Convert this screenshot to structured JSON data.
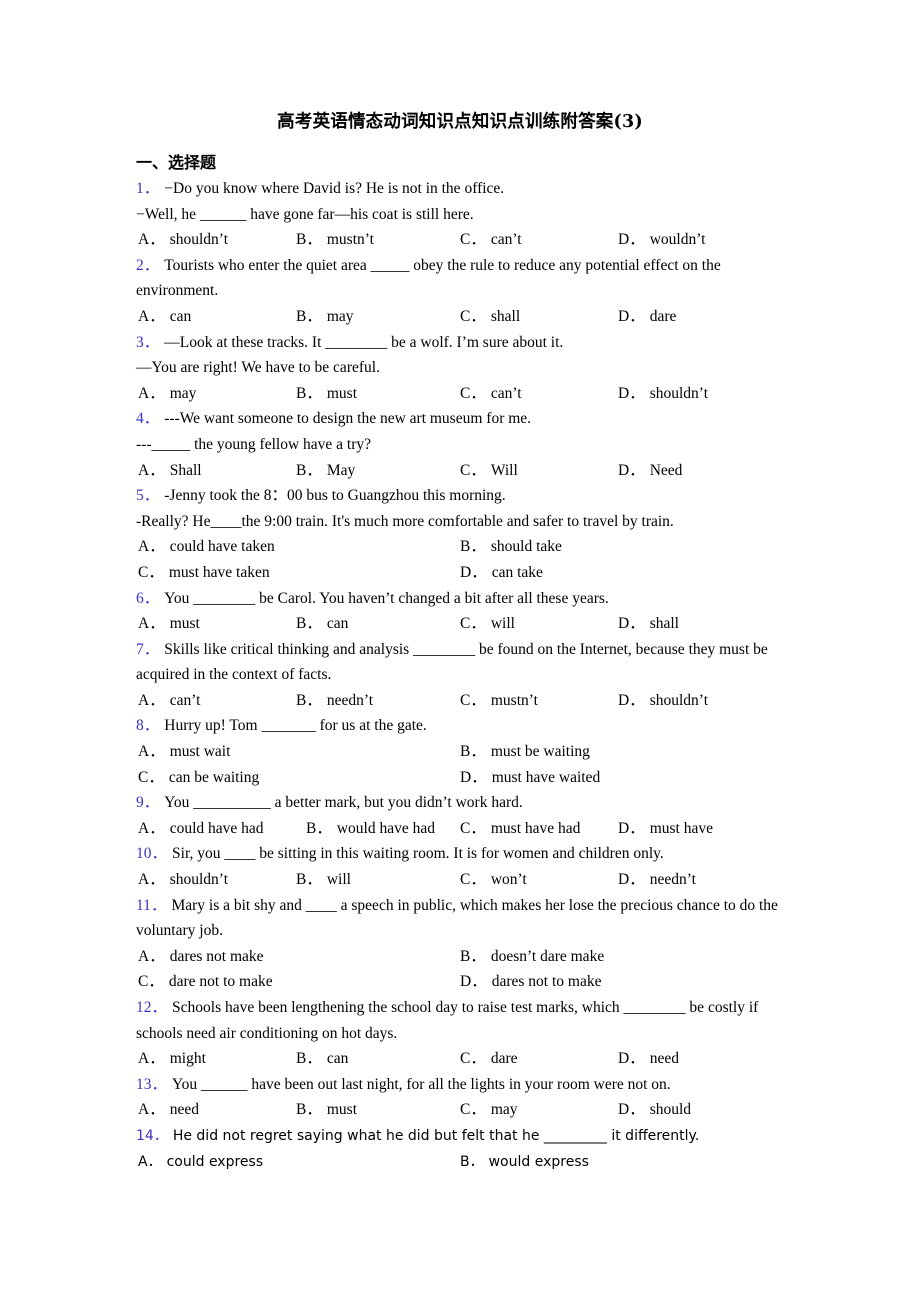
{
  "document": {
    "title": "高考英语情态动词知识点知识点训练附答案(3)",
    "section_heading": "一、选择题",
    "number_color": "#3b34c4",
    "text_color": "#000000",
    "background": "#ffffff"
  },
  "questions": [
    {
      "number": "1",
      "layout": "four-column",
      "stem_lines": [
        "−Do you know where David is? He is not in the office.",
        "−Well, he ______ have gone far—his coat is still here."
      ],
      "options": [
        {
          "label": "A",
          "text": "shouldn’t"
        },
        {
          "label": "B",
          "text": "mustn’t"
        },
        {
          "label": "C",
          "text": "can’t"
        },
        {
          "label": "D",
          "text": "wouldn’t"
        }
      ]
    },
    {
      "number": "2",
      "layout": "four-column",
      "stem_lines": [
        "Tourists who enter the quiet area _____ obey the rule to reduce any potential effect on the environment."
      ],
      "options": [
        {
          "label": "A",
          "text": "can"
        },
        {
          "label": "B",
          "text": "may"
        },
        {
          "label": "C",
          "text": "shall"
        },
        {
          "label": "D",
          "text": "dare"
        }
      ]
    },
    {
      "number": "3",
      "layout": "four-column",
      "stem_lines": [
        "—Look at these tracks. It ________ be a wolf. I’m sure about it.",
        "—You are right! We have to be careful."
      ],
      "options": [
        {
          "label": "A",
          "text": "may"
        },
        {
          "label": "B",
          "text": "must"
        },
        {
          "label": "C",
          "text": "can’t"
        },
        {
          "label": "D",
          "text": "shouldn’t"
        }
      ]
    },
    {
      "number": "4",
      "layout": "four-column",
      "stem_lines": [
        "---We want someone to design the new art museum for me.",
        "---_____ the young fellow have a try?"
      ],
      "options": [
        {
          "label": "A",
          "text": "Shall"
        },
        {
          "label": "B",
          "text": "May"
        },
        {
          "label": "C",
          "text": "Will"
        },
        {
          "label": "D",
          "text": "Need"
        }
      ]
    },
    {
      "number": "5",
      "layout": "two-column",
      "stem_lines": [
        "-Jenny took the 8：00 bus to Guangzhou this morning.",
        "-Really? He____the 9:00 train. It's much more  comfortable and safer to travel by train."
      ],
      "options": [
        {
          "label": "A",
          "text": "could have taken"
        },
        {
          "label": "B",
          "text": "should take"
        },
        {
          "label": "C",
          "text": "must have taken"
        },
        {
          "label": "D",
          "text": "can take"
        }
      ]
    },
    {
      "number": "6",
      "layout": "four-column",
      "stem_lines": [
        "You ________ be Carol. You haven’t changed a bit after all these years."
      ],
      "options": [
        {
          "label": "A",
          "text": "must"
        },
        {
          "label": "B",
          "text": "can"
        },
        {
          "label": "C",
          "text": "will"
        },
        {
          "label": "D",
          "text": "shall"
        }
      ]
    },
    {
      "number": "7",
      "layout": "four-column",
      "stem_lines": [
        "Skills like critical thinking and analysis ________ be found on the Internet, because they must be acquired in the context of facts."
      ],
      "options": [
        {
          "label": "A",
          "text": "can’t"
        },
        {
          "label": "B",
          "text": "needn’t"
        },
        {
          "label": "C",
          "text": "mustn’t"
        },
        {
          "label": "D",
          "text": "shouldn’t"
        }
      ]
    },
    {
      "number": "8",
      "layout": "two-column",
      "stem_lines": [
        "Hurry up! Tom _______ for us at the gate."
      ],
      "options": [
        {
          "label": "A",
          "text": "must wait"
        },
        {
          "label": "B",
          "text": "must be waiting"
        },
        {
          "label": "C",
          "text": "can be waiting"
        },
        {
          "label": "D",
          "text": "must have waited"
        }
      ]
    },
    {
      "number": "9",
      "layout": "four-column-tight",
      "stem_lines": [
        "You __________ a better mark, but you didn’t work hard."
      ],
      "options": [
        {
          "label": "A",
          "text": "could have had"
        },
        {
          "label": "B",
          "text": "would have had"
        },
        {
          "label": "C",
          "text": "must have had"
        },
        {
          "label": "D",
          "text": "must have"
        }
      ]
    },
    {
      "number": "10",
      "layout": "four-column",
      "stem_lines": [
        "Sir, you ____ be sitting in this waiting room. It is for women and children only."
      ],
      "options": [
        {
          "label": "A",
          "text": "shouldn’t"
        },
        {
          "label": "B",
          "text": "will"
        },
        {
          "label": "C",
          "text": "won’t"
        },
        {
          "label": "D",
          "text": "needn’t"
        }
      ]
    },
    {
      "number": "11",
      "layout": "two-column",
      "stem_lines": [
        "Mary is a bit shy and ____ a speech in public, which makes her lose the precious chance to do the voluntary job."
      ],
      "options": [
        {
          "label": "A",
          "text": "dares not make"
        },
        {
          "label": "B",
          "text": "doesn’t dare make"
        },
        {
          "label": "C",
          "text": "dare not to make"
        },
        {
          "label": "D",
          "text": "dares not to make"
        }
      ]
    },
    {
      "number": "12",
      "layout": "four-column",
      "stem_lines": [
        "Schools have been lengthening the school day to raise test marks, which ________ be costly if schools need air conditioning on hot days."
      ],
      "options": [
        {
          "label": "A",
          "text": "might"
        },
        {
          "label": "B",
          "text": "can"
        },
        {
          "label": "C",
          "text": "dare"
        },
        {
          "label": "D",
          "text": "need"
        }
      ]
    },
    {
      "number": "13",
      "layout": "four-column",
      "stem_lines": [
        "You ______ have been out last night, for all the lights in your room were not on."
      ],
      "options": [
        {
          "label": "A",
          "text": "need"
        },
        {
          "label": "B",
          "text": "must"
        },
        {
          "label": "C",
          "text": "may"
        },
        {
          "label": "D",
          "text": "should"
        }
      ]
    },
    {
      "number": "14",
      "layout": "two-column",
      "font": "sans",
      "stem_lines": [
        "He did not regret saying what he did but felt that he _________ it differently."
      ],
      "options": [
        {
          "label": "A",
          "text": "could express"
        },
        {
          "label": "B",
          "text": "would express"
        }
      ]
    }
  ]
}
